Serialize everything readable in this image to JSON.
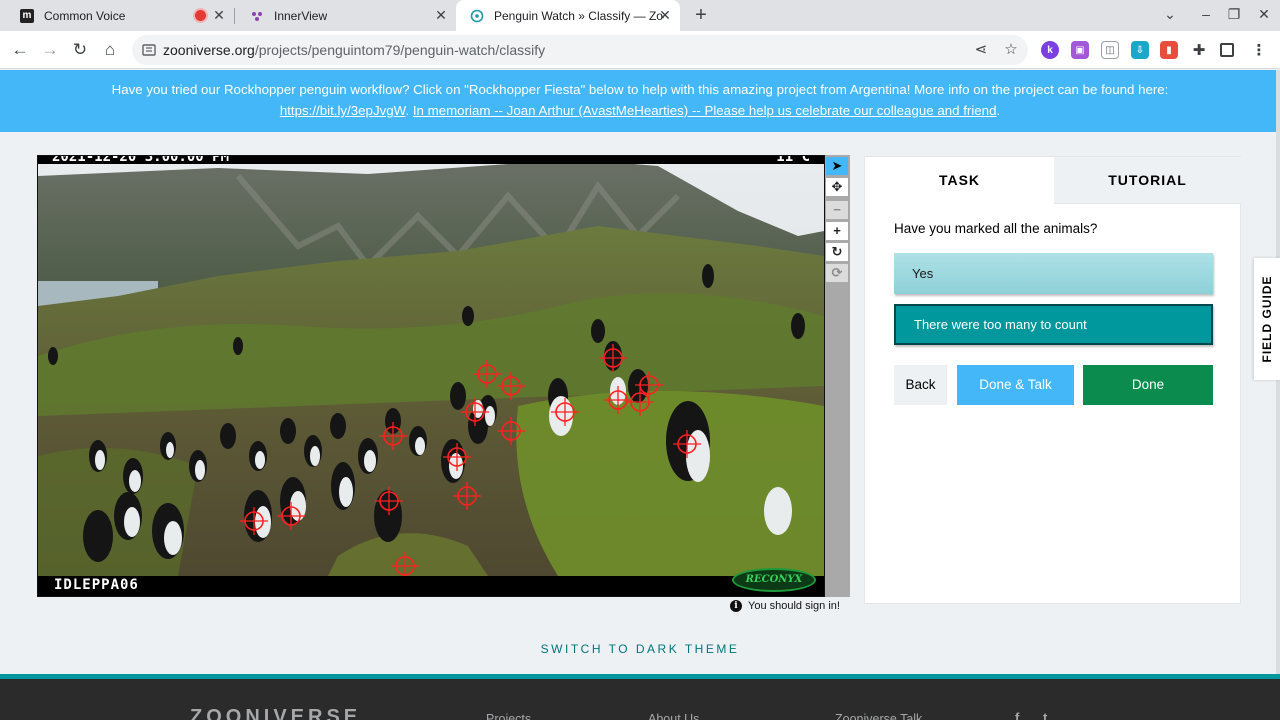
{
  "browser": {
    "tabs": [
      {
        "title": "Common Voice",
        "favicon": "common-voice-icon",
        "recording": true
      },
      {
        "title": "InnerView",
        "favicon": "innerview-icon"
      },
      {
        "title": "Penguin Watch » Classify — Zoo",
        "favicon": "zooniverse-icon",
        "active": true
      }
    ],
    "url_host": "zooniverse.org",
    "url_path": "/projects/penguintom79/penguin-watch/classify"
  },
  "banner": {
    "text": "Have you tried our Rockhopper penguin workflow? Click on \"Rockhopper Fiesta\" below to help with this amazing project from Argentina! More info on the project can be found here:",
    "link1": "https://bit.ly/3epJvgW",
    "link2": "In memoriam -- Joan Arthur (AvastMeHearties) -- Please help us celebrate our colleague and friend",
    "sep": ". ",
    "end": "."
  },
  "subject": {
    "timestamp": "2021-12-20  3:00:00 PM",
    "temperature": "11°C",
    "camera_id": "IDLEPPA06",
    "brand": "RECONYX",
    "marks_count": 17
  },
  "signin_notice": "You should sign in!",
  "task_panel": {
    "tab_task": "TASK",
    "tab_tutorial": "TUTORIAL",
    "question": "Have you marked all the animals?",
    "answers": [
      "Yes",
      "There were too many to count"
    ],
    "back": "Back",
    "done_talk": "Done & Talk",
    "done": "Done"
  },
  "field_guide": "FIELD GUIDE",
  "dark_theme": "SWITCH TO DARK THEME",
  "footer": {
    "logo": "ZOONIVERSE",
    "links": [
      "Projects",
      "About Us",
      "Zooniverse Talk"
    ],
    "social": [
      "f",
      "t"
    ]
  },
  "colors": {
    "banner": "#43b7f7",
    "teal": "#00979d",
    "done_green": "#0b8c4e",
    "mark_red": "#ff2020"
  }
}
